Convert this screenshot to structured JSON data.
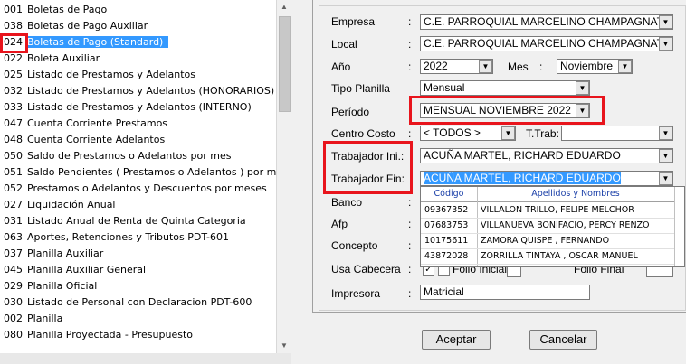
{
  "reports": [
    {
      "code": "001",
      "label": "Boletas de Pago"
    },
    {
      "code": "038",
      "label": "Boletas de Pago Auxiliar"
    },
    {
      "code": "024",
      "label": "Boletas de Pago (Standard)"
    },
    {
      "code": "022",
      "label": "Boleta Auxiliar"
    },
    {
      "code": "025",
      "label": "Listado de Prestamos y Adelantos"
    },
    {
      "code": "032",
      "label": "Listado de Prestamos y Adelantos (HONORARIOS)"
    },
    {
      "code": "033",
      "label": "Listado de Prestamos y Adelantos (INTERNO)"
    },
    {
      "code": "047",
      "label": "Cuenta Corriente Prestamos"
    },
    {
      "code": "048",
      "label": "Cuenta Corriente Adelantos"
    },
    {
      "code": "050",
      "label": "Saldo  de Prestamos o Adelantos   por mes"
    },
    {
      "code": "051",
      "label": "Saldo Pendientes ( Prestamos o Adelantos ) por m"
    },
    {
      "code": "052",
      "label": "Prestamos o Adelantos  y Descuentos por meses"
    },
    {
      "code": "027",
      "label": "Liquidación Anual"
    },
    {
      "code": "031",
      "label": "Listado Anual de Renta de Quinta Categoria"
    },
    {
      "code": "063",
      "label": "Aportes, Retenciones y Tributos  PDT-601"
    },
    {
      "code": "037",
      "label": "Planilla Auxiliar"
    },
    {
      "code": "045",
      "label": "Planilla Auxiliar General"
    },
    {
      "code": "029",
      "label": "Planilla Oficial"
    },
    {
      "code": "030",
      "label": "Listado de Personal con Declaracion PDT-600"
    },
    {
      "code": "002",
      "label": "Planilla"
    },
    {
      "code": "080",
      "label": "Planilla Proyectada - Presupuesto"
    }
  ],
  "form": {
    "empresa_label": "Empresa",
    "empresa_value": "C.E. PARROQUIAL MARCELINO CHAMPAGNAT",
    "local_label": "Local",
    "local_value": "C.E. PARROQUIAL MARCELINO CHAMPAGNAT",
    "anio_label": "Año",
    "anio_value": "2022",
    "mes_label": "Mes",
    "mes_value": "Noviembre",
    "tipo_planilla_label": "Tipo Planilla",
    "tipo_planilla_value": "Mensual",
    "periodo_label": "Período",
    "periodo_value": "MENSUAL NOVIEMBRE 2022",
    "centro_costo_label": "Centro Costo",
    "centro_costo_value": "< TODOS >",
    "ttrab_label": "T.Trab:",
    "trab_ini_label": "Trabajador Ini.:",
    "trab_ini_value": "ACUÑA MARTEL, RICHARD EDUARDO",
    "trab_fin_label": "Trabajador Fin:",
    "trab_fin_value": "ACUÑA MARTEL, RICHARD EDUARDO",
    "banco_label": "Banco",
    "afp_label": "Afp",
    "concepto_label": "Concepto",
    "usa_cabecera_label": "Usa Cabecera",
    "folio_inicial_label": "Folio Inicial",
    "folio_final_label": "Folio Final",
    "impresora_label": "Impresora",
    "impresora_value": "Matricial",
    "colon": ":"
  },
  "worker_dropdown": {
    "col_codigo": "Código",
    "col_nombres": "Apellidos y Nombres",
    "rows": [
      {
        "codigo": "09367352",
        "nombre": "VILLALON TRILLO, FELIPE MELCHOR"
      },
      {
        "codigo": "07683753",
        "nombre": "VILLANUEVA BONIFACIO, PERCY RENZO"
      },
      {
        "codigo": "10175611",
        "nombre": "ZAMORA  QUISPE , FERNANDO"
      },
      {
        "codigo": "43872028",
        "nombre": "ZORRILLA TINTAYA , OSCAR MANUEL"
      }
    ]
  },
  "buttons": {
    "aceptar": "Aceptar",
    "cancelar": "Cancelar"
  },
  "highlight_color": "#e8141c",
  "selection_color": "#3399ff"
}
